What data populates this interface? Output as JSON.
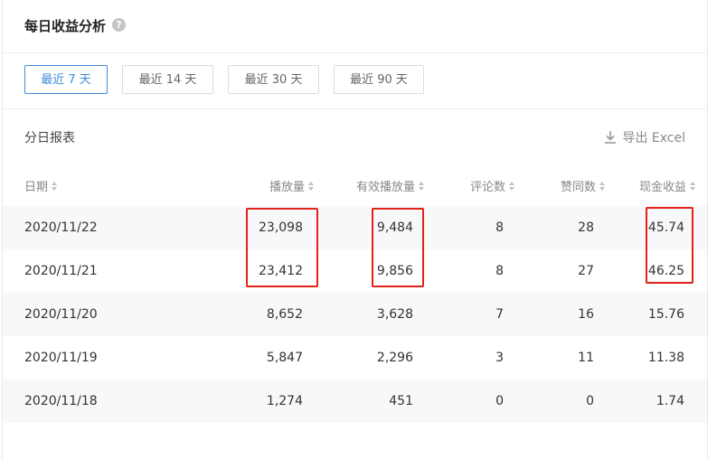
{
  "header": {
    "title": "每日收益分析",
    "help_icon": "?"
  },
  "ranges": [
    {
      "label": "最近 7 天",
      "active": true
    },
    {
      "label": "最近 14 天",
      "active": false
    },
    {
      "label": "最近 30 天",
      "active": false
    },
    {
      "label": "最近 90 天",
      "active": false
    }
  ],
  "report": {
    "title": "分日报表",
    "export_label": "导出 Excel",
    "export_icon": "download-icon"
  },
  "table": {
    "columns": [
      "日期",
      "播放量",
      "有效播放量",
      "评论数",
      "赞同数",
      "现金收益"
    ],
    "rows": [
      [
        "2020/11/22",
        "23,098",
        "9,484",
        "8",
        "28",
        "45.74"
      ],
      [
        "2020/11/21",
        "23,412",
        "9,856",
        "8",
        "27",
        "46.25"
      ],
      [
        "2020/11/20",
        "8,652",
        "3,628",
        "7",
        "16",
        "15.76"
      ],
      [
        "2020/11/19",
        "5,847",
        "2,296",
        "3",
        "11",
        "11.38"
      ],
      [
        "2020/11/18",
        "1,274",
        "451",
        "0",
        "0",
        "1.74"
      ]
    ]
  },
  "colors": {
    "accent": "#3e8cd9",
    "highlight": "#e2231a",
    "stripe": "#f7f8fa"
  }
}
